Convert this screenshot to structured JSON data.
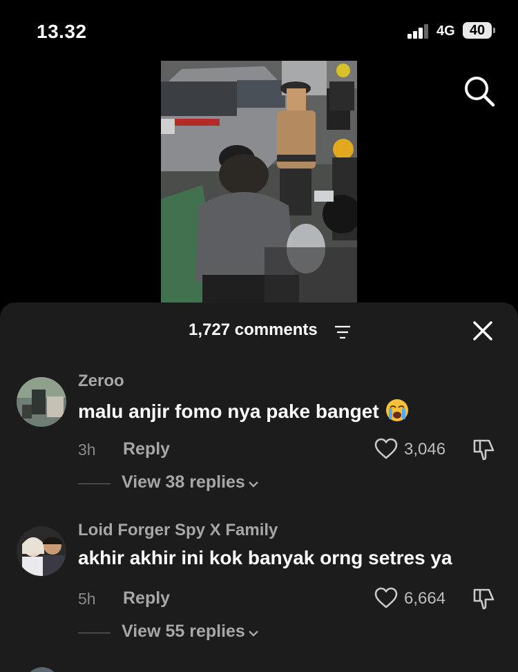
{
  "status_bar": {
    "time": "13.32",
    "network": "4G",
    "battery": "40"
  },
  "video": {
    "search_icon": "search-icon"
  },
  "comments": {
    "count_label": "1,727 comments",
    "filter_icon": "sort-lines-icon",
    "close_icon": "close-icon",
    "items": [
      {
        "username": "Zeroo",
        "text": "malu anjir fomo nya pake banget",
        "emoji": "loudly-crying-face",
        "time": "3h",
        "reply_label": "Reply",
        "likes": "3,046",
        "view_replies": "View 38 replies"
      },
      {
        "username": "Loid Forger Spy X Family",
        "text": "akhir akhir ini kok banyak orng setres ya",
        "time": "5h",
        "reply_label": "Reply",
        "likes": "6,664",
        "view_replies": "View 55 replies"
      }
    ]
  },
  "colors": {
    "background": "#000000",
    "sheet": "#1c1c1c",
    "muted_text": "#a7a7a7"
  }
}
